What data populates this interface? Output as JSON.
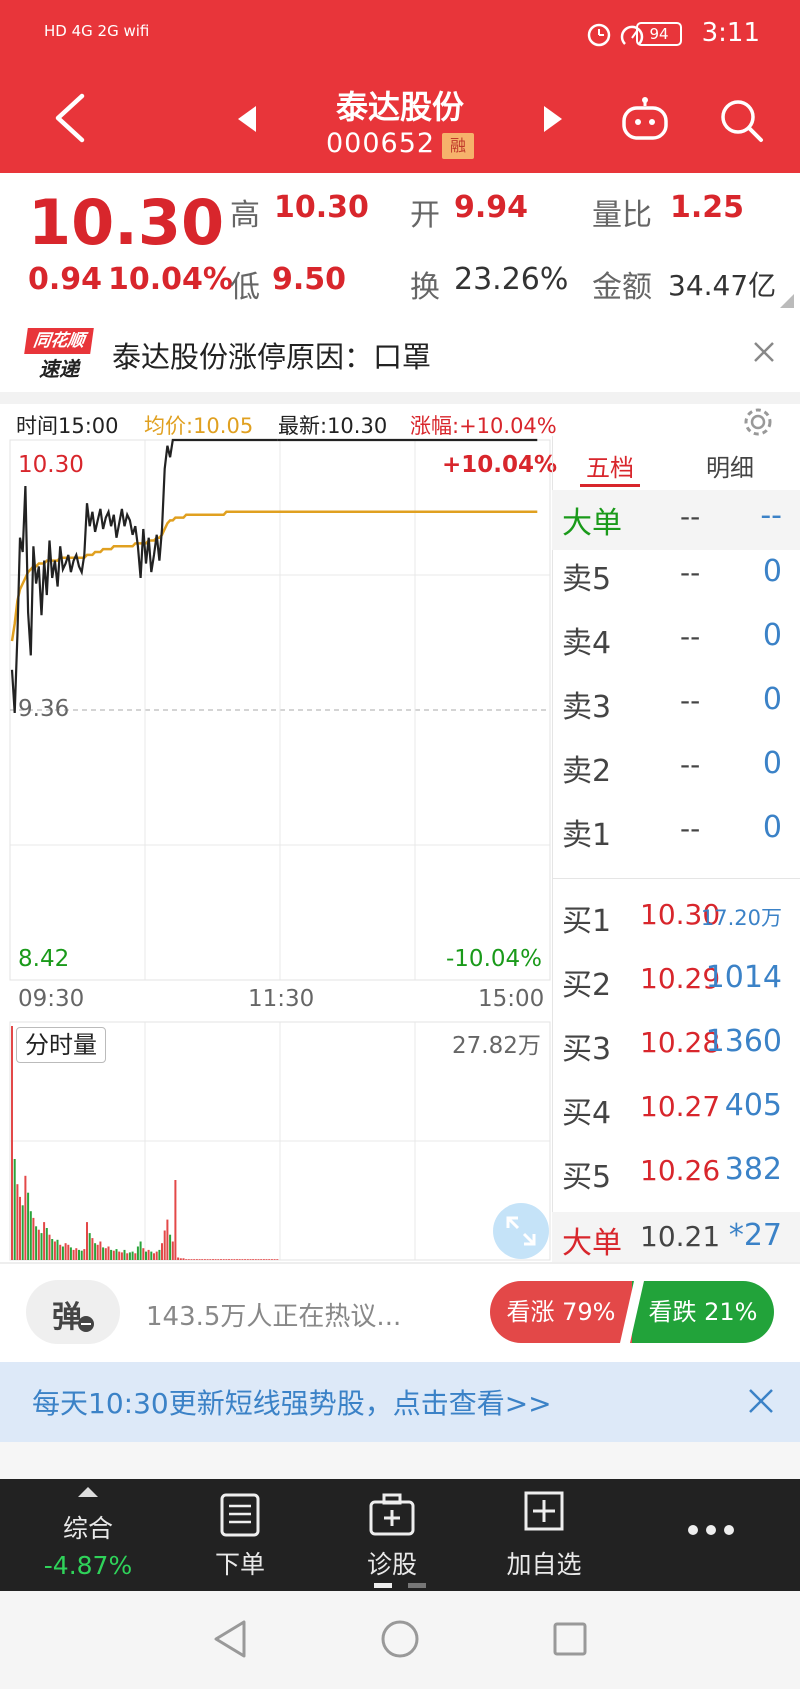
{
  "status_bar": {
    "left_icons": "HD 4G 2G wifi",
    "battery": "94",
    "time": "3:11"
  },
  "header": {
    "title": "泰达股份",
    "code": "000652",
    "margin_badge": "融"
  },
  "quote": {
    "price": "10.30",
    "change": "0.94",
    "change_pct": "10.04%",
    "high_label": "高",
    "high": "10.30",
    "low_label": "低",
    "low": "9.50",
    "open_label": "开",
    "open": "9.94",
    "turnover_label": "换",
    "turnover": "23.26%",
    "volume_ratio_label": "量比",
    "volume_ratio": "1.25",
    "amount_label": "金额",
    "amount": "34.47亿"
  },
  "news": {
    "logo_top": "同花顺",
    "logo_bottom": "速递",
    "text": "泰达股份涨停原因：口罩"
  },
  "chart_header": {
    "time": "时间15:00",
    "avg": "均价:10.05",
    "latest": "最新:10.30",
    "change": "涨幅:+10.04%"
  },
  "chart_labels": {
    "top_price": "10.30",
    "top_pct": "+10.04%",
    "mid_price": "9.36",
    "bottom_price": "8.42",
    "bottom_pct": "-10.04%",
    "x_start": "09:30",
    "x_mid": "11:30",
    "x_end": "15:00",
    "volume_tag": "分时量",
    "volume_max": "27.82万"
  },
  "chart_data": {
    "type": "line",
    "ylim": [
      8.42,
      10.3
    ],
    "x_ticks": [
      "09:30",
      "11:30",
      "15:00"
    ],
    "series": [
      {
        "values": [
          9.5,
          9.35,
          9.62,
          9.96,
          9.91,
          10.14,
          9.7,
          9.55,
          9.93,
          9.8,
          9.86,
          9.69,
          9.88,
          9.76,
          9.95,
          9.82,
          9.88,
          9.79,
          9.93,
          9.85,
          9.87,
          9.9,
          9.84,
          9.88,
          9.9,
          9.86,
          9.84,
          9.9,
          10.08,
          10.0,
          10.05,
          9.98,
          10.02,
          10.06,
          9.99,
          10.03,
          10.05,
          10.0,
          10.04,
          9.96,
          10.01,
          10.06,
          10.0,
          10.04,
          10.02,
          9.97,
          10.0,
          9.93,
          9.82,
          9.99,
          9.87,
          9.96,
          9.84,
          9.9,
          9.97,
          9.88,
          9.99,
          10.2,
          10.28,
          10.24,
          10.3,
          10.3,
          10.3,
          10.3,
          10.3,
          10.3,
          10.3,
          10.3,
          10.3,
          10.3,
          10.3,
          10.3,
          10.3,
          10.3,
          10.3,
          10.3,
          10.3,
          10.3,
          10.3,
          10.3,
          10.3,
          10.3,
          10.3,
          10.3,
          10.3,
          10.3,
          10.3,
          10.3,
          10.3,
          10.3,
          10.3,
          10.3,
          10.3,
          10.3,
          10.3,
          10.3,
          10.3,
          10.3,
          10.3,
          10.3
        ]
      },
      {
        "values": [
          9.6,
          9.66,
          9.74,
          9.78,
          9.8,
          9.82,
          9.84,
          9.85,
          9.86,
          9.86,
          9.87,
          9.87,
          9.87,
          9.88,
          9.88,
          9.88,
          9.88,
          9.88,
          9.89,
          9.89,
          9.89,
          9.89,
          9.89,
          9.89,
          9.89,
          9.89,
          9.89,
          9.89,
          9.9,
          9.9,
          9.9,
          9.91,
          9.91,
          9.91,
          9.92,
          9.92,
          9.92,
          9.92,
          9.93,
          9.93,
          9.93,
          9.93,
          9.93,
          9.93,
          9.93,
          9.93,
          9.94,
          9.94,
          9.94,
          9.94,
          9.94,
          9.95,
          9.95,
          9.95,
          9.96,
          9.96,
          9.97,
          9.99,
          10.01,
          10.02,
          10.02,
          10.03,
          10.03,
          10.03,
          10.03,
          10.04,
          10.04,
          10.04,
          10.04,
          10.04,
          10.04,
          10.04,
          10.04,
          10.04,
          10.04,
          10.04,
          10.04,
          10.04,
          10.04,
          10.04,
          10.05,
          10.05,
          10.05,
          10.05,
          10.05,
          10.05,
          10.05,
          10.05,
          10.05,
          10.05,
          10.05,
          10.05,
          10.05,
          10.05,
          10.05,
          10.05,
          10.05,
          10.05,
          10.05,
          10.05
        ]
      }
    ],
    "volume": [
      27.8,
      12,
      9,
      7.5,
      6.5,
      10,
      8,
      5.8,
      5,
      4,
      3.6,
      3.2,
      4.5,
      3.8,
      3,
      2.5,
      2.2,
      2.4,
      1.8,
      1.6,
      2,
      1.8,
      1.5,
      1.2,
      1.4,
      1.2,
      1.1,
      1.3,
      4.5,
      3.2,
      2.6,
      2,
      1.8,
      2.2,
      1.5,
      1.4,
      1.6,
      1.2,
      1.1,
      1.3,
      1,
      0.9,
      1.2,
      0.8,
      0.9,
      1,
      0.8,
      1.6,
      2.2,
      1.4,
      1,
      1.2,
      1,
      0.8,
      1,
      1.2,
      2,
      3.5,
      4.8,
      3,
      2.2,
      9.5,
      0.3,
      0.2,
      0.2,
      0.1,
      0.1,
      0.1,
      0.1,
      0.1,
      0.1,
      0.1,
      0.1,
      0.1,
      0.1,
      0.1,
      0.1,
      0.1,
      0.1,
      0.1,
      0.1,
      0.1,
      0.1,
      0.1,
      0.1,
      0.1,
      0.1,
      0.1,
      0.1,
      0.1,
      0.1,
      0.1,
      0.1,
      0.1,
      0.1,
      0.1,
      0.1,
      0.1,
      0.1,
      0.1
    ]
  },
  "order_book": {
    "tab_five": "五档",
    "tab_detail": "明细",
    "big_sell": {
      "label": "大单",
      "price": "--",
      "vol": "--"
    },
    "sells": [
      {
        "label": "卖5",
        "price": "--",
        "vol": "0"
      },
      {
        "label": "卖4",
        "price": "--",
        "vol": "0"
      },
      {
        "label": "卖3",
        "price": "--",
        "vol": "0"
      },
      {
        "label": "卖2",
        "price": "--",
        "vol": "0"
      },
      {
        "label": "卖1",
        "price": "--",
        "vol": "0"
      }
    ],
    "buys": [
      {
        "label": "买1",
        "price": "10.30",
        "vol": "17.20万"
      },
      {
        "label": "买2",
        "price": "10.29",
        "vol": "1014"
      },
      {
        "label": "买3",
        "price": "10.28",
        "vol": "1360"
      },
      {
        "label": "买4",
        "price": "10.27",
        "vol": "405"
      },
      {
        "label": "买5",
        "price": "10.26",
        "vol": "382"
      }
    ],
    "big_buy": {
      "label": "大单",
      "price": "10.21",
      "vol": "*27"
    }
  },
  "discussion": {
    "danmu": "弹",
    "text": "143.5万人正在热议...",
    "bull": "看涨 79%",
    "bear": "看跌 21%",
    "bull_fraction": 0.79
  },
  "promo": {
    "text": "每天10:30更新短线强势股，点击查看>>"
  },
  "bottom_nav": {
    "composite_label": "综合",
    "composite_value": "-4.87%",
    "order": "下单",
    "diagnose": "诊股",
    "add_watch": "加自选"
  },
  "colors": {
    "header_red": "#e8353a",
    "up_red": "#d8262c",
    "down_green": "#1a9a1a",
    "avg_orange": "#e0a020",
    "vol_blue": "#3b82c7"
  }
}
